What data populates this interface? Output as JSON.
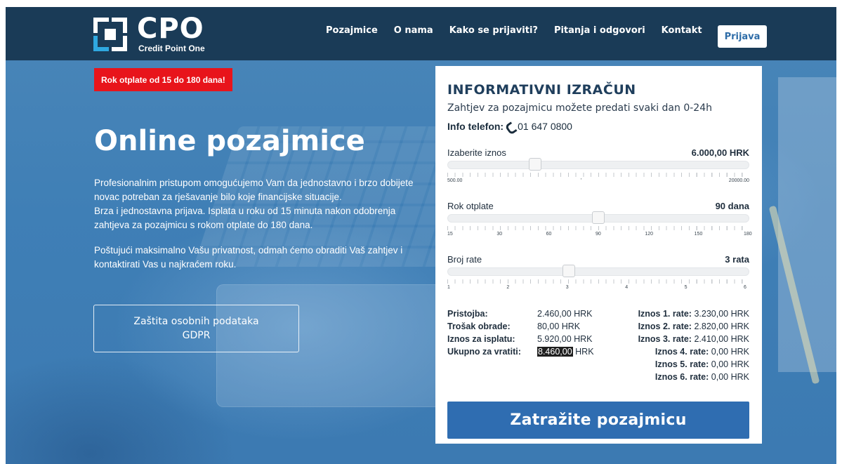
{
  "brand": {
    "name": "CPO",
    "subtitle": "Credit Point One"
  },
  "nav": {
    "items": [
      "Pozajmice",
      "O nama",
      "Kako se prijaviti?",
      "Pitanja i odgovori",
      "Kontakt"
    ],
    "login_label": "Prijava"
  },
  "hero": {
    "promo_badge": "Rok otplate od 15 do 180 dana!",
    "title": "Online pozajmice",
    "paragraph1": "Profesionalnim pristupom omogućujemo Vam da jednostavno i brzo dobijete novac potreban za rješavanje bilo koje financijske situacije.",
    "paragraph2": "Brza i jednostavna prijava. Isplata u roku od 15 minuta nakon odobrenja zahtjeva za pozajmicu s rokom otplate do 180 dana.",
    "paragraph3": "Poštujući maksimalno Vašu privatnost, odmah ćemo obraditi Vaš zahtjev i kontaktirati Vas u najkraćem roku.",
    "gdpr_line1": "Zaštita osobnih podataka",
    "gdpr_line2": "GDPR"
  },
  "calculator": {
    "title": "INFORMATIVNI IZRAČUN",
    "subtitle": "Zahtjev za pozajmicu možete predati svaki dan 0-24h",
    "phone_label": "Info telefon:",
    "phone_number": "01 647 0800",
    "amount": {
      "label": "Izaberite iznos",
      "value": "6.000,00 HRK",
      "min_label": "500.00",
      "max_label": "20000.00",
      "min": 500,
      "max": 20000,
      "current": 6000,
      "mid_tick_label": "'"
    },
    "term": {
      "label": "Rok otplate",
      "value": "90 dana",
      "tick_labels": [
        "15",
        "30",
        "60",
        "90",
        "120",
        "150",
        "180"
      ],
      "current_index": 3
    },
    "installments": {
      "label": "Broj rate",
      "value": "3 rata",
      "tick_labels": [
        "1",
        "2",
        "3",
        "4",
        "5",
        "6"
      ],
      "current_index": 2
    },
    "summary_left": [
      {
        "key": "Pristojba:",
        "value": "2.460,00 HRK"
      },
      {
        "key": "Trošak obrade:",
        "value": "80,00 HRK"
      },
      {
        "key": "Iznos za isplatu:",
        "value": "5.920,00 HRK"
      },
      {
        "key": "Ukupno za vratiti:",
        "value_highlight": "8.460,00",
        "value_unit": "HRK"
      }
    ],
    "summary_right": [
      {
        "key": "Iznos 1. rate:",
        "value": "3.230,00 HRK"
      },
      {
        "key": "Iznos 2. rate:",
        "value": "2.820,00 HRK"
      },
      {
        "key": "Iznos 3. rate:",
        "value": "2.410,00 HRK"
      },
      {
        "key": "Iznos 4. rate:",
        "value": "0,00 HRK"
      },
      {
        "key": "Iznos 5. rate:",
        "value": "0,00 HRK"
      },
      {
        "key": "Iznos 6. rate:",
        "value": "0,00 HRK"
      }
    ],
    "cta_label": "Zatražite pozajmicu"
  }
}
